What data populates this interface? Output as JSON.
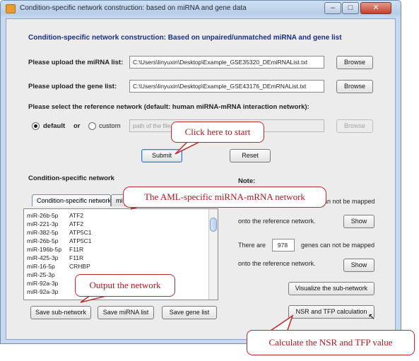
{
  "window": {
    "title": "Condition-specific network construction: based on miRNA and gene data",
    "minimize_symbol": "–",
    "maximize_symbol": "□",
    "close_symbol": "✕"
  },
  "form": {
    "heading": "Condition-specific network construction:  Based on unpaired/unmatched miRNA and gene list",
    "mirna_label": "Please upload the miRNA list:",
    "mirna_path": "C:\\Users\\linyuxin\\Desktop\\Example_GSE35320_DEmiRNAList.txt",
    "gene_label": "Please upload the gene list:",
    "gene_path": "C:\\Users\\linyuxin\\Desktop\\Example_GSE43176_DEmRNAList.txt",
    "browse_label": "Browse",
    "reference_label": "Please select the reference network (default: human miRNA-mRNA interaction network):",
    "default_option": "default",
    "or_text": "or",
    "custom_option": "custom",
    "custom_placeholder": "path of the file",
    "submit_label": "Submit",
    "reset_label": "Reset"
  },
  "network": {
    "section_label": "Condition-specific network",
    "tabs": [
      "Condition-specific network",
      "mi"
    ],
    "rows": [
      {
        "mirna": "miR-26b-5p",
        "gene": "ATF2"
      },
      {
        "mirna": "miR-221-3p",
        "gene": "ATF2"
      },
      {
        "mirna": "miR-382-5p",
        "gene": "ATP5C1"
      },
      {
        "mirna": "miR-26b-5p",
        "gene": "ATP5C1"
      },
      {
        "mirna": "miR-196b-5p",
        "gene": "F11R"
      },
      {
        "mirna": "miR-425-3p",
        "gene": "F11R"
      },
      {
        "mirna": "miR-16-5p",
        "gene": "CRHBP"
      },
      {
        "mirna": "miR-25-3p",
        "gene": ""
      },
      {
        "mirna": "miR-92a-3p",
        "gene": ""
      },
      {
        "mirna": "miR-92a-3p",
        "gene": ""
      }
    ],
    "save_subnetwork_label": "Save sub-network",
    "save_mirna_label": "Save miRNA list",
    "save_gene_label": "Save gene list"
  },
  "note": {
    "label": "Note:",
    "line1_tail": "an not be mapped",
    "line2": "onto the reference network.",
    "there_are": "There are",
    "gene_count": "978",
    "genes_tail": "genes can not be mapped",
    "line4": "onto the reference network.",
    "show_label": "Show",
    "visualize_label": "Visualize the sub-network",
    "nsr_tfp_label": "NSR and TFP calculation"
  },
  "annotations": {
    "start": "Click here to start",
    "network": "The AML-specific miRNA-mRNA network",
    "output": "Output the network",
    "calc": "Calculate the NSR and TFP value"
  }
}
